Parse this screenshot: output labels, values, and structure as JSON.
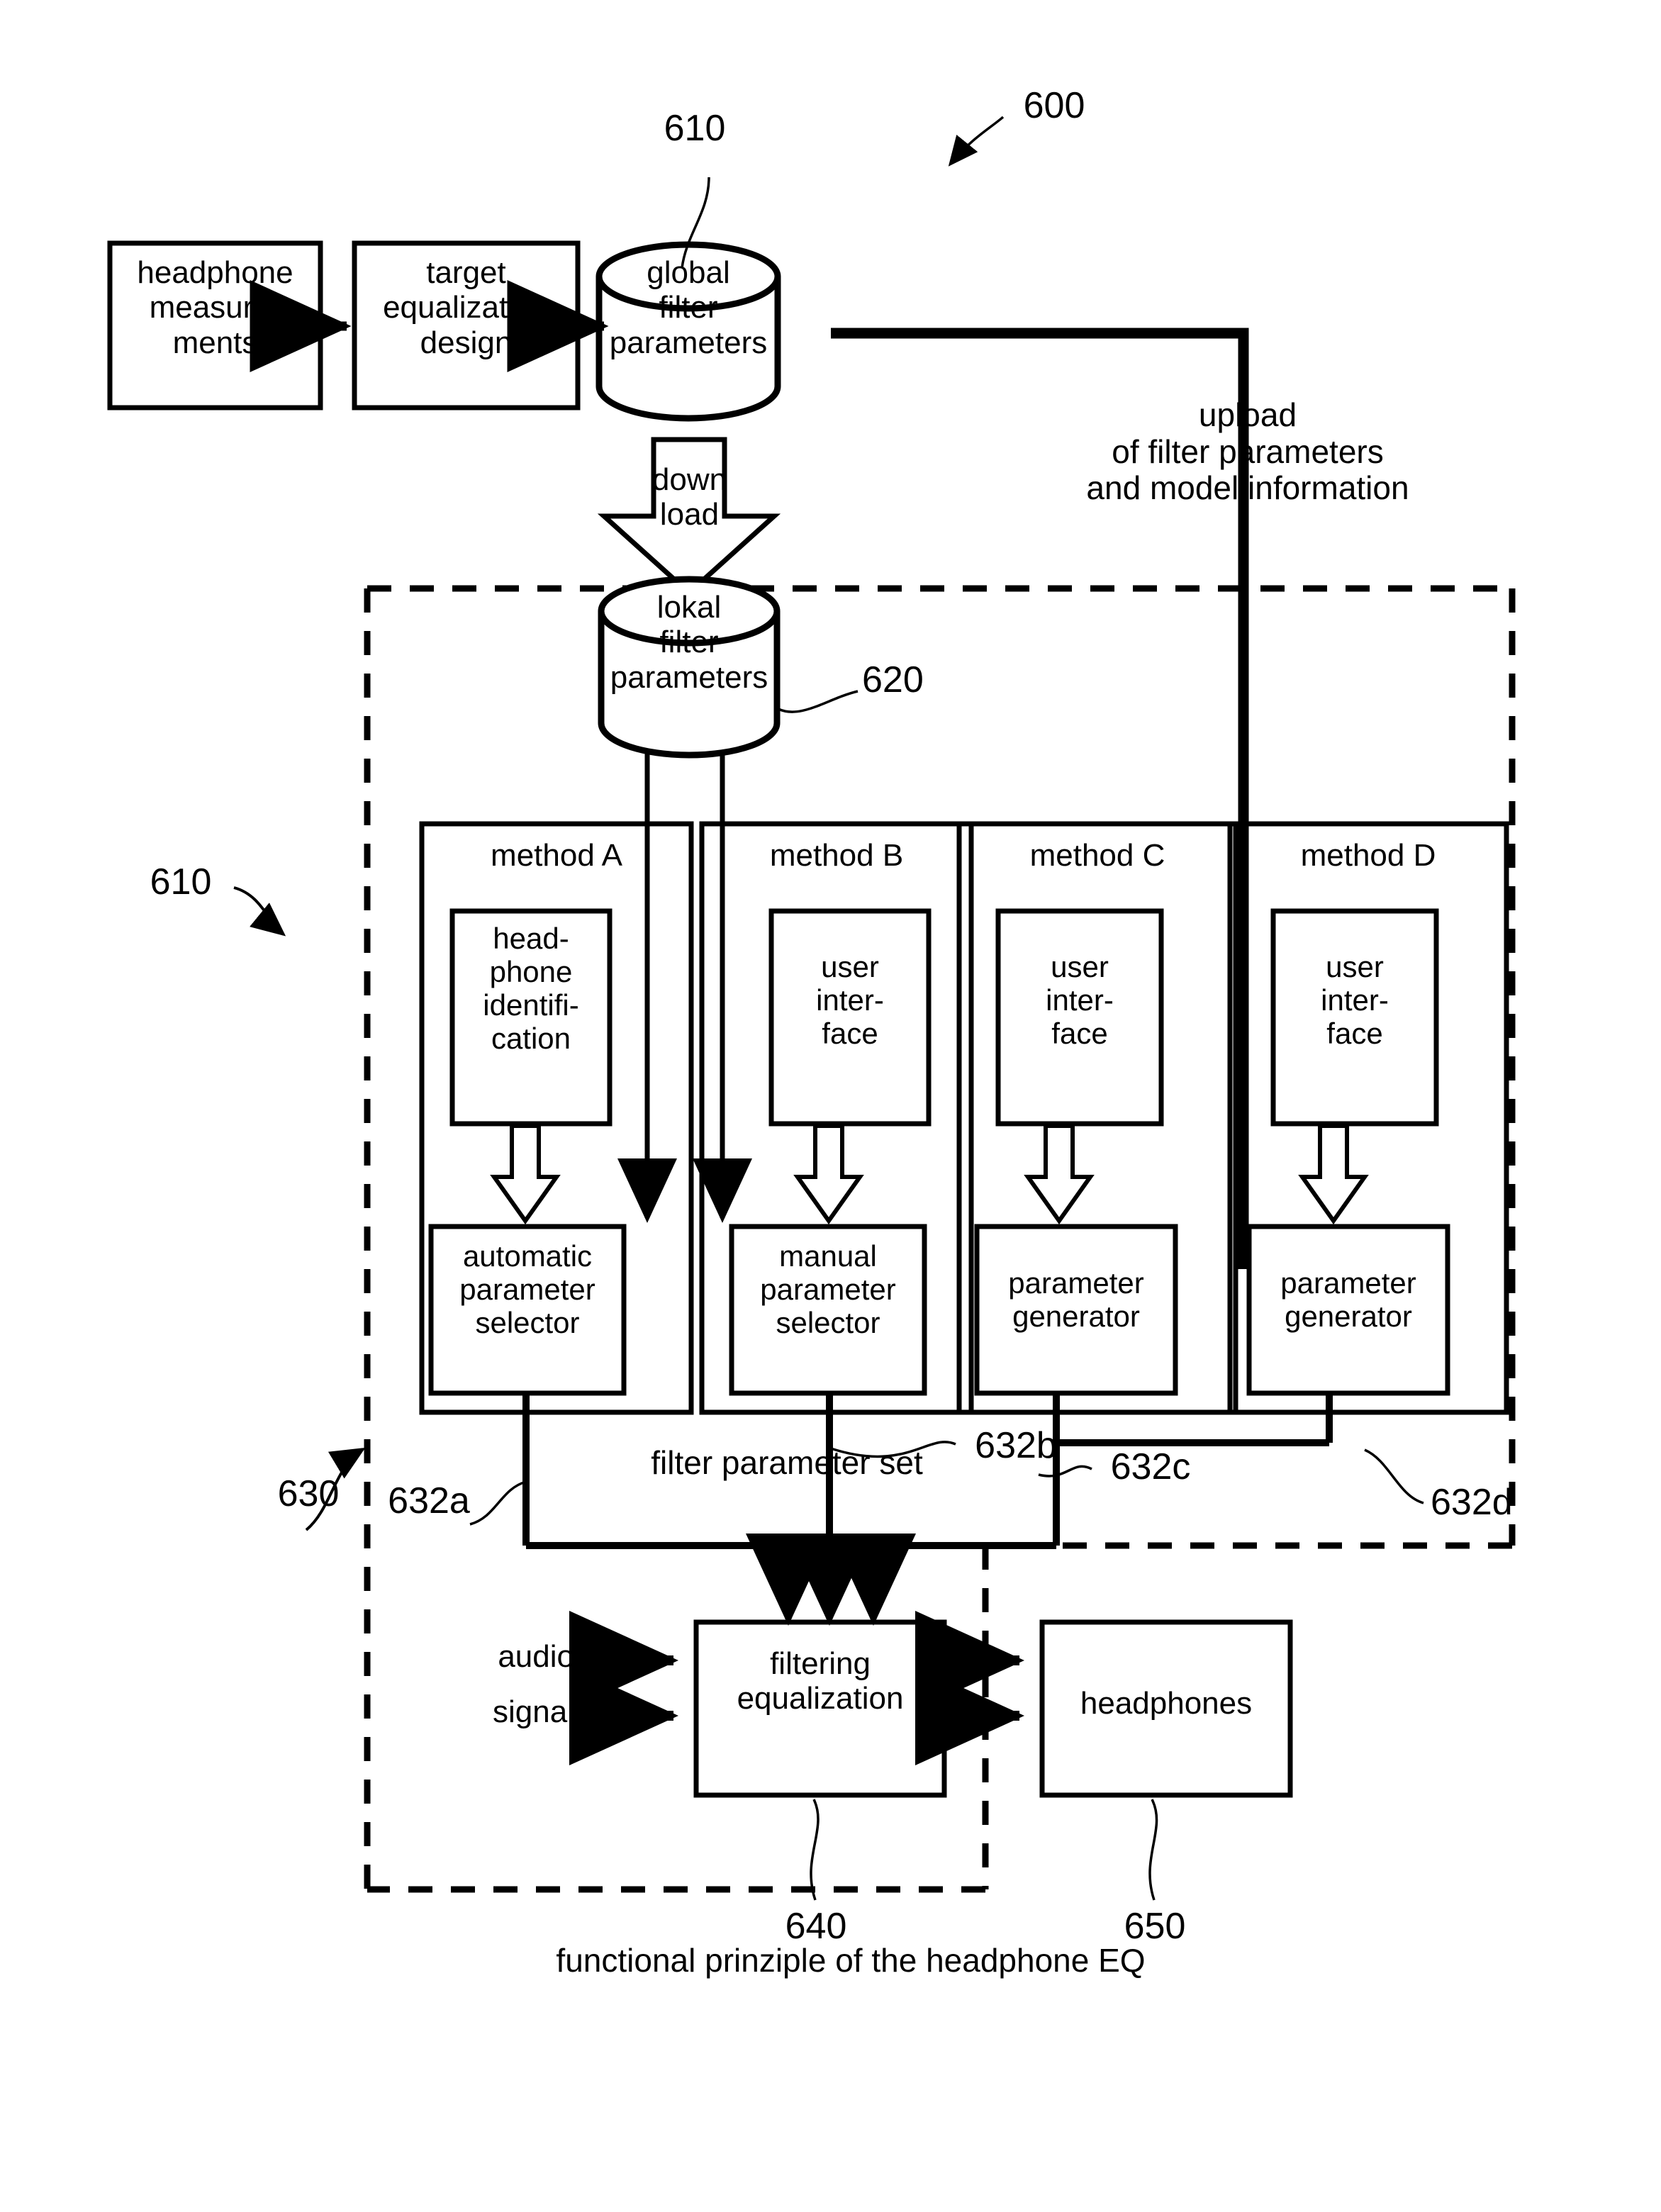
{
  "figure": {
    "number": "600",
    "caption": "functional prinziple of the headphone EQ"
  },
  "source_stage": {
    "headphone_measurements": "headphone\nmeasure-\nments",
    "target_equalization_design": "target\nequalization\ndesign",
    "global_filter_parameters": "global\nfilter\nparameters",
    "global_filter_parameters_ref": "610"
  },
  "transfer": {
    "download_label": "down\nload",
    "upload_label": "upload\nof filter parameters\nand model information"
  },
  "device": {
    "local_filter_parameters": "lokal\nfilter\nparameters",
    "local_filter_parameters_ref": "620",
    "device_ref": "610",
    "methods_group_ref": "630",
    "filter_parameter_set_label": "filter parameter set"
  },
  "methods": [
    {
      "title": "method A",
      "ref": "632a",
      "upper_box": "head-\nphone\nidentifi-\ncation",
      "lower_box": "automatic\nparameter\nselector"
    },
    {
      "title": "method B",
      "ref": "632b",
      "upper_box": "user\ninter-\nface",
      "lower_box": "manual\nparameter\nselector"
    },
    {
      "title": "method C",
      "ref": "632c",
      "upper_box": "user\ninter-\nface",
      "lower_box": "parameter\ngenerator"
    },
    {
      "title": "method D",
      "ref": "632d",
      "upper_box": "user\ninter-\nface",
      "lower_box": "parameter\ngenerator"
    }
  ],
  "output_stage": {
    "audio_label": "audio",
    "signal_label": "signal",
    "filtering_equalization": "filtering\nequalization",
    "filtering_equalization_ref": "640",
    "headphones": "headphones",
    "headphones_ref": "650"
  },
  "style": {
    "stroke": "#000000",
    "background": "#ffffff"
  }
}
